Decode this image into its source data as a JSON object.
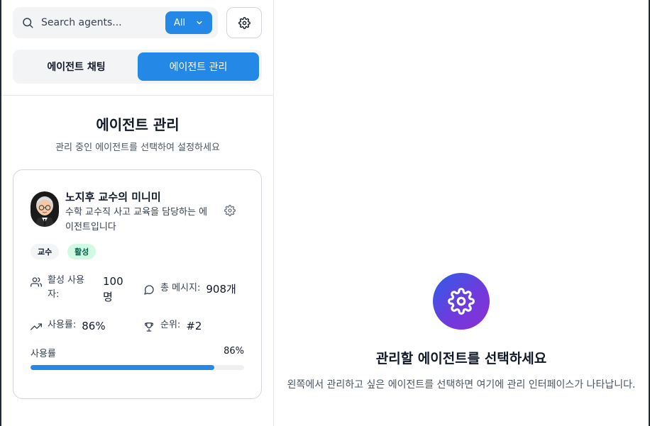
{
  "search": {
    "placeholder": "Search agents...",
    "filter_label": "All"
  },
  "tabs": [
    {
      "label": "에이전트 채팅",
      "active": false
    },
    {
      "label": "에이전트 관리",
      "active": true
    }
  ],
  "section": {
    "title": "에이전트 관리",
    "subtitle": "관리 중인 에이전트를 선택하여 설정하세요"
  },
  "agent": {
    "name": "노지후 교수의 미니미",
    "description": "수학 교수직 사고 교육을 담당하는 에이전트입니다",
    "tags": [
      "교수",
      "활성"
    ],
    "stats": {
      "active_users_label": "활성 사용자:",
      "active_users_value": "100명",
      "messages_label": "총 메시지:",
      "messages_value": "908개",
      "usage_label": "사용률:",
      "usage_value": "86%",
      "rank_label": "순위:",
      "rank_value": "#2"
    },
    "progress": {
      "label": "사용률",
      "percent_text": "86%",
      "value": 0.86
    }
  },
  "main": {
    "empty_title": "관리할 에이전트를 선택하세요",
    "empty_description": "왼쪽에서 관리하고 싶은 에이전트를 선택하면 여기에 관리 인터페이스가 나타납니다."
  },
  "colors": {
    "accent": "#2388e6",
    "tag_active_bg": "#d1fae5",
    "icon_gradient_start": "#2c5ee8",
    "icon_gradient_end": "#8b2fd6"
  },
  "icons": {
    "search": "search-icon",
    "filter_chevron": "chevron-down-icon",
    "settings": "gear-icon",
    "users": "users-icon",
    "messages": "message-circle-icon",
    "usage": "trending-up-icon",
    "rank": "trophy-icon"
  }
}
